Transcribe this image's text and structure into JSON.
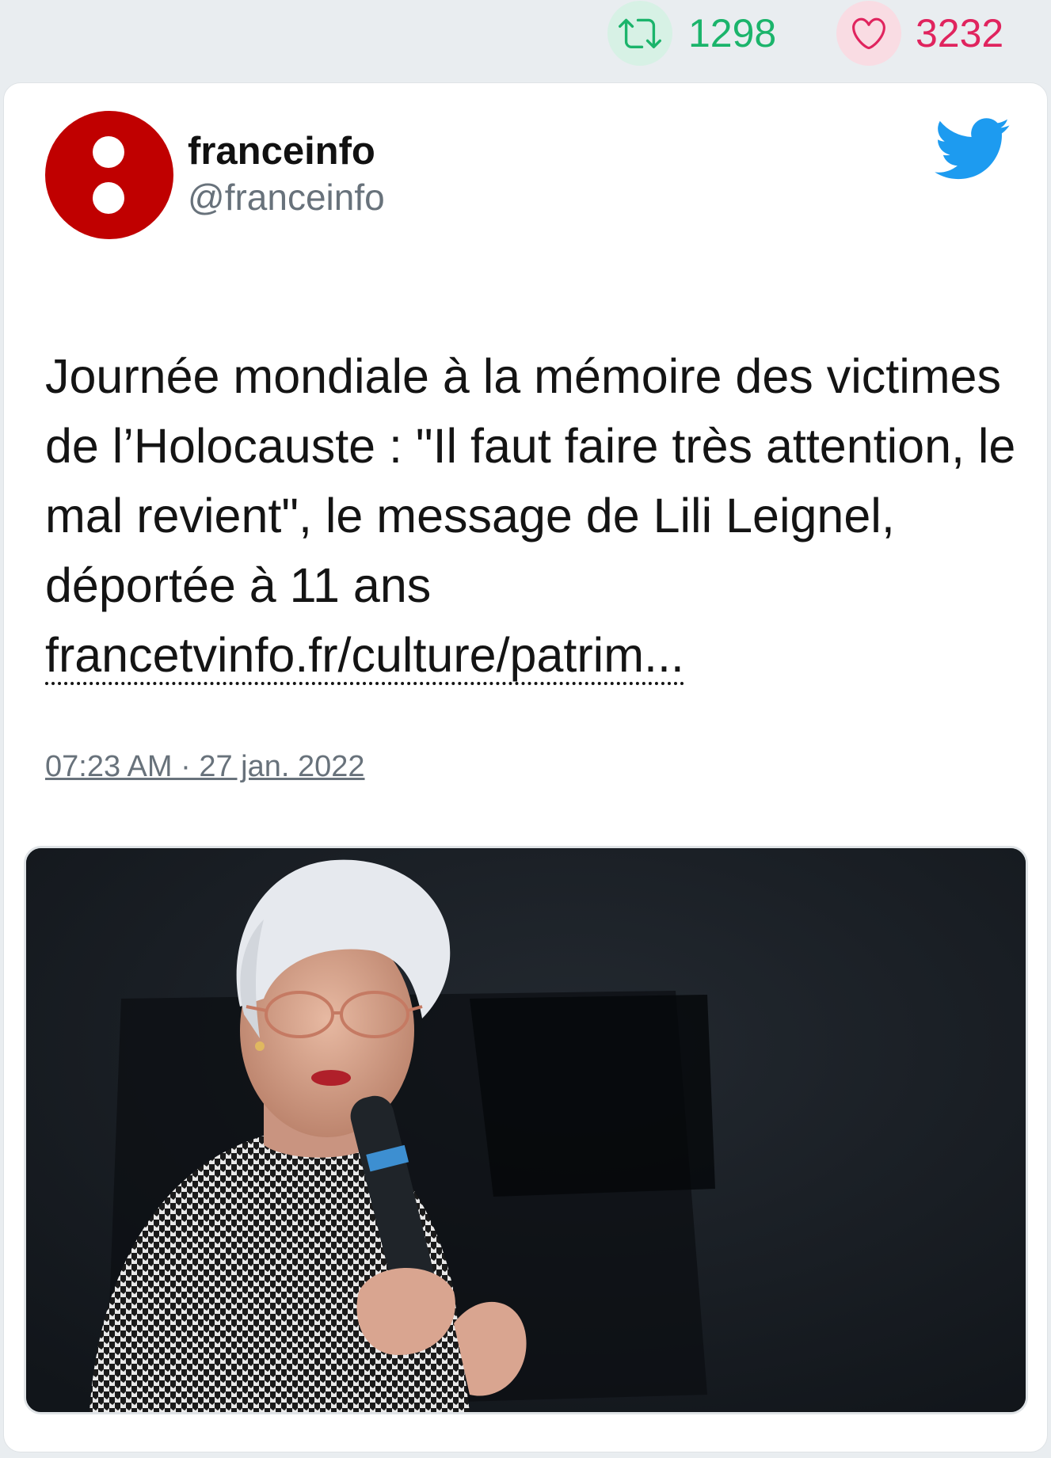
{
  "stats": {
    "retweets": "1298",
    "likes": "3232",
    "retweet_icon": "retweet-icon",
    "like_icon": "heart-icon",
    "retweet_color": "#1bb46b",
    "like_color": "#e0245e"
  },
  "tweet": {
    "author_name": "franceinfo",
    "author_handle": "@franceinfo",
    "avatar_color": "#c00000",
    "text": "Journée mondiale à la mémoire des victimes de l’Holocauste : \"Il faut faire très attention, le mal revient\", le message de Lili Leignel, déportée à 11 ans",
    "link_text": "francetvinfo.fr/culture/patrim...",
    "timestamp": "07:23 AM · 27 jan. 2022",
    "brand_icon": "twitter-bird-icon",
    "brand_color": "#1d9bf0"
  },
  "actions": {
    "reply_icon": "reply-icon",
    "retweet_icon": "retweet-icon",
    "like_icon": "heart-icon"
  },
  "media": {
    "image": "photo"
  }
}
